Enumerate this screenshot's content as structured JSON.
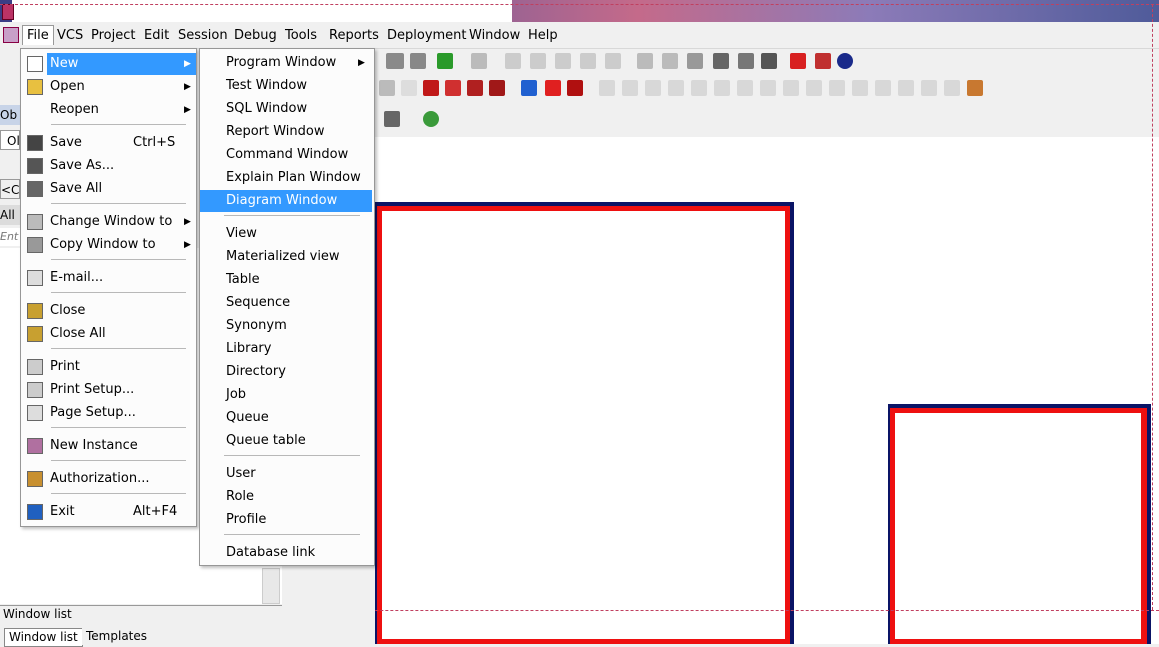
{
  "menubar": {
    "items": [
      "File",
      "VCS",
      "Project",
      "Edit",
      "Session",
      "Debug",
      "Tools",
      "Reports",
      "Deployment",
      "Window",
      "Help"
    ]
  },
  "file_menu": {
    "items": [
      {
        "label": "New",
        "shortcut": "",
        "submenu": true,
        "icon": "new-file-icon"
      },
      {
        "label": "Open",
        "shortcut": "",
        "submenu": true,
        "icon": "open-folder-icon"
      },
      {
        "label": "Reopen",
        "shortcut": "",
        "submenu": true,
        "icon": ""
      },
      {
        "label": "Save",
        "shortcut": "Ctrl+S",
        "submenu": false,
        "icon": "save-icon"
      },
      {
        "label": "Save As...",
        "shortcut": "",
        "submenu": false,
        "icon": "save-as-icon"
      },
      {
        "label": "Save All",
        "shortcut": "",
        "submenu": false,
        "icon": "save-all-icon"
      },
      {
        "label": "Change Window to",
        "shortcut": "",
        "submenu": true,
        "icon": "change-window-icon"
      },
      {
        "label": "Copy Window to",
        "shortcut": "",
        "submenu": true,
        "icon": "copy-window-icon"
      },
      {
        "label": "E-mail...",
        "shortcut": "",
        "submenu": false,
        "icon": "email-icon"
      },
      {
        "label": "Close",
        "shortcut": "",
        "submenu": false,
        "icon": "close-folder-icon"
      },
      {
        "label": "Close All",
        "shortcut": "",
        "submenu": false,
        "icon": "close-all-icon"
      },
      {
        "label": "Print",
        "shortcut": "",
        "submenu": false,
        "icon": "print-icon"
      },
      {
        "label": "Print Setup...",
        "shortcut": "",
        "submenu": false,
        "icon": "print-setup-icon"
      },
      {
        "label": "Page Setup...",
        "shortcut": "",
        "submenu": false,
        "icon": "page-setup-icon"
      },
      {
        "label": "New Instance",
        "shortcut": "",
        "submenu": false,
        "icon": "new-instance-icon"
      },
      {
        "label": "Authorization...",
        "shortcut": "",
        "submenu": false,
        "icon": "lock-icon"
      },
      {
        "label": "Exit",
        "shortcut": "Alt+F4",
        "submenu": false,
        "icon": "exit-icon"
      }
    ]
  },
  "new_submenu": {
    "items": [
      {
        "label": "Program Window",
        "submenu": true
      },
      {
        "label": "Test Window",
        "submenu": false
      },
      {
        "label": "SQL Window",
        "submenu": false
      },
      {
        "label": "Report Window",
        "submenu": false
      },
      {
        "label": "Command Window",
        "submenu": false
      },
      {
        "label": "Explain Plan Window",
        "submenu": false
      },
      {
        "label": "Diagram Window",
        "submenu": false
      },
      {
        "label": "View",
        "submenu": false
      },
      {
        "label": "Materialized view",
        "submenu": false
      },
      {
        "label": "Table",
        "submenu": false
      },
      {
        "label": "Sequence",
        "submenu": false
      },
      {
        "label": "Synonym",
        "submenu": false
      },
      {
        "label": "Library",
        "submenu": false
      },
      {
        "label": "Directory",
        "submenu": false
      },
      {
        "label": "Job",
        "submenu": false
      },
      {
        "label": "Queue",
        "submenu": false
      },
      {
        "label": "Queue table",
        "submenu": false
      },
      {
        "label": "User",
        "submenu": false
      },
      {
        "label": "Role",
        "submenu": false
      },
      {
        "label": "Profile",
        "submenu": false
      },
      {
        "label": "Database link",
        "submenu": false
      }
    ]
  },
  "left_panel": {
    "ob_label": "Ob",
    "ol_label": "Ol",
    "back_label": "<C",
    "all_label": "All",
    "entry_placeholder": "Ent"
  },
  "window_list": {
    "title": "Window list",
    "tabs": [
      "Window list",
      "Templates"
    ]
  },
  "colors": {
    "highlight": "#3399ff",
    "diagram_border_red": "#ee1010",
    "diagram_border_navy": "#0a1466"
  }
}
